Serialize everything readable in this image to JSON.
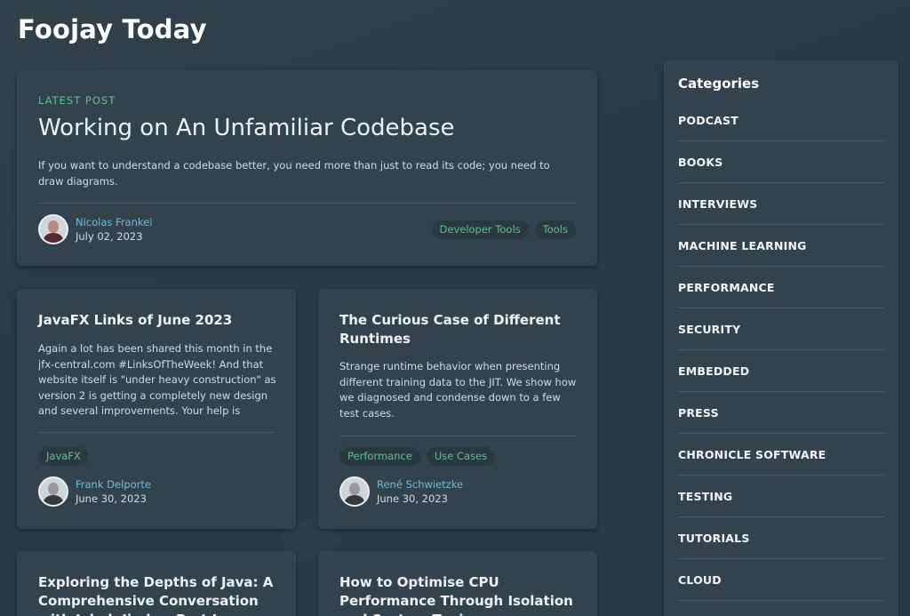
{
  "site": {
    "title": "Foojay Today"
  },
  "featured": {
    "kicker": "LATEST POST",
    "title": "Working on An Unfamiliar Codebase",
    "description": "If you want to understand a codebase better, you need more than just to read its code; you need to draw diagrams.",
    "author": "Nicolas Frankel",
    "date": "July 02, 2023",
    "tags": [
      "Developer Tools",
      "Tools"
    ]
  },
  "posts": [
    {
      "title": "JavaFX Links of June 2023",
      "description": "Again a lot has been shared this month in the jfx-central.com #LinksOfTheWeek! And that website itself is \"under heavy construction\" as version 2 is getting a completely new design and several improvements. Your help is wanted! See the las...",
      "tags": [
        "JavaFX"
      ],
      "author": "Frank Delporte",
      "date": "June 30, 2023"
    },
    {
      "title": "The Curious Case of Different Runtimes",
      "description": "Strange runtime behavior when presenting different training data to the JIT. We show how we diagnosed and condense down to a few test cases.",
      "tags": [
        "Performance",
        "Use Cases"
      ],
      "author": "René Schwietzke",
      "date": "June 30, 2023"
    },
    {
      "title": "Exploring the Depths of Java: A Comprehensive Conversation with Jakub Jindra, Part I",
      "description": "",
      "tags": [],
      "author": "",
      "date": ""
    },
    {
      "title": "How to Optimise CPU Performance Through Isolation and System Tuning",
      "description": "",
      "tags": [],
      "author": "",
      "date": ""
    }
  ],
  "sidebar": {
    "heading": "Categories",
    "categories": [
      "PODCAST",
      "BOOKS",
      "INTERVIEWS",
      "MACHINE LEARNING",
      "PERFORMANCE",
      "SECURITY",
      "EMBEDDED",
      "PRESS",
      "CHRONICLE SOFTWARE",
      "TESTING",
      "TUTORIALS",
      "CLOUD"
    ]
  }
}
